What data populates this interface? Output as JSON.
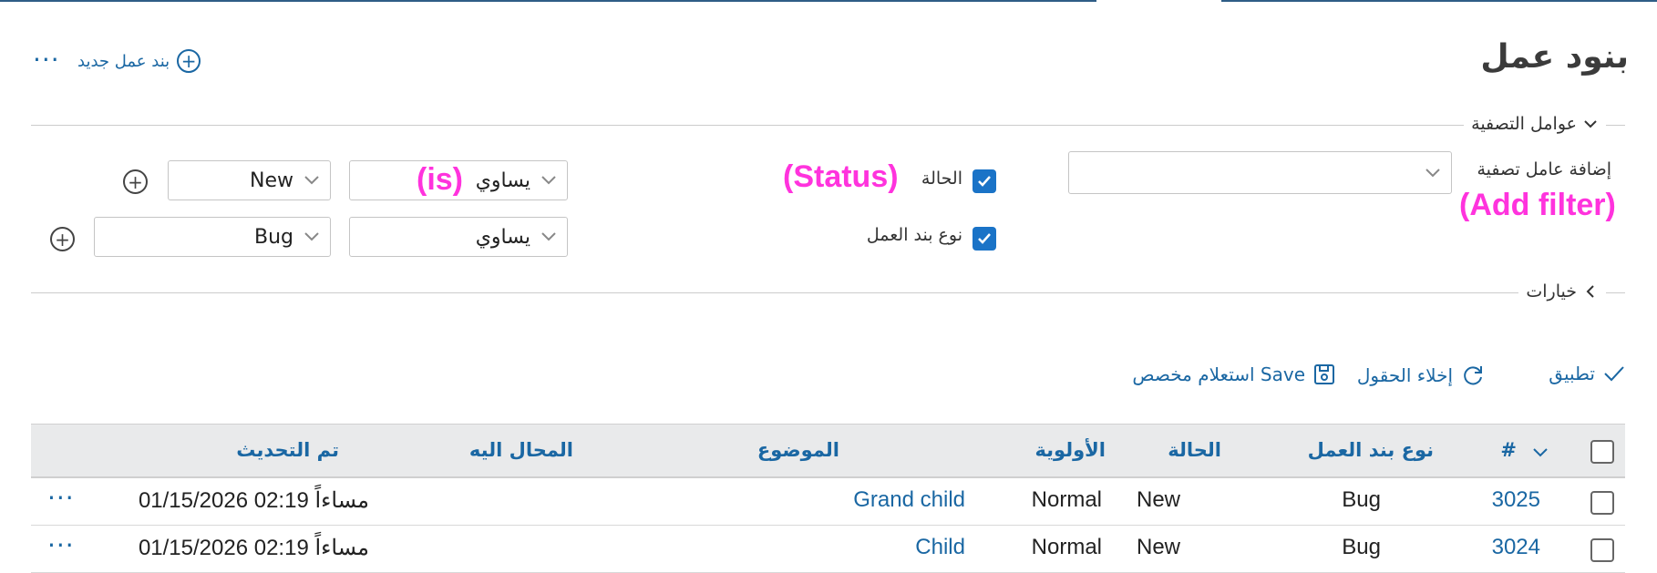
{
  "page": {
    "title": "بنود عمل",
    "new_work_package_label": "بند عمل جديد",
    "more_menu_label": "···"
  },
  "filters": {
    "section_title": "عوامل التصفية",
    "add_filter_label": "إضافة عامل تصفية",
    "add_filter_annotation": "(Add filter)",
    "rows": [
      {
        "checkbox_label": "الحالة",
        "label_annotation": "(Status)",
        "operator_value": "يساوي",
        "operator_annotation": "(is)",
        "value": "New"
      },
      {
        "checkbox_label": "نوع بند العمل",
        "operator_value": "يساوي",
        "value": "Bug"
      }
    ]
  },
  "options": {
    "section_title": "خيارات"
  },
  "actions": {
    "apply": "تطبيق",
    "clear": "إخلاء الحقول",
    "save": "Save استعلام مخصص"
  },
  "table": {
    "columns": [
      "#",
      "نوع بند العمل",
      "الحالة",
      "الأولوية",
      "الموضوع",
      "المحال اليه",
      "تم التحديث"
    ],
    "rows": [
      {
        "id": "3025",
        "type": "Bug",
        "status": "New",
        "priority": "Normal",
        "subject": "Grand child",
        "assignee": "",
        "updated": "مساءاً 02:19 01/15/2026"
      },
      {
        "id": "3024",
        "type": "Bug",
        "status": "New",
        "priority": "Normal",
        "subject": "Child",
        "assignee": "",
        "updated": "مساءاً 02:19 01/15/2026"
      }
    ]
  },
  "icons": {
    "plus_circle": "plus-circle-icon",
    "chevron_down": "chevron-down-icon",
    "chevron_left": "chevron-left-icon",
    "check": "check-icon",
    "refresh": "refresh-icon",
    "save": "save-icon",
    "more": "more-horizontal-icon"
  },
  "colors": {
    "link": "#1a67a3",
    "annotation": "#ff33dd",
    "checkbox": "#1a73c7",
    "header_bg": "#e9eaeb"
  }
}
